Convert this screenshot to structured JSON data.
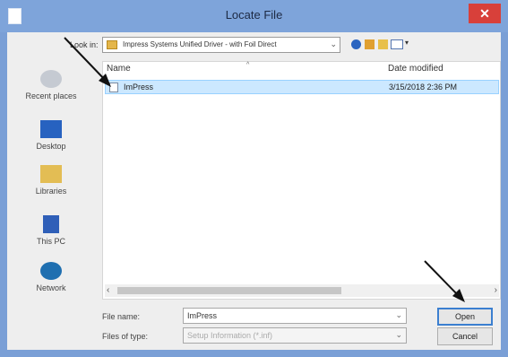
{
  "window": {
    "title": "Locate File",
    "close_glyph": "✕"
  },
  "toolbar": {
    "look_in_label": "Look in:",
    "look_in_value": "Impress Systems Unified Driver - with Foil Direct",
    "look_in_icon": "folder-icon",
    "icons": [
      "back-icon",
      "up-folder-icon",
      "new-folder-icon",
      "views-menu-icon"
    ]
  },
  "places": [
    {
      "label": "Recent places",
      "icon": "recent-places-icon"
    },
    {
      "label": "Desktop",
      "icon": "desktop-icon"
    },
    {
      "label": "Libraries",
      "icon": "libraries-icon"
    },
    {
      "label": "This PC",
      "icon": "this-pc-icon"
    },
    {
      "label": "Network",
      "icon": "network-icon"
    }
  ],
  "filelist": {
    "columns": {
      "name": "Name",
      "date": "Date modified"
    },
    "rows": [
      {
        "name": "ImPress",
        "date": "3/15/2018 2:36 PM",
        "selected": true
      }
    ]
  },
  "form": {
    "file_name_label": "File name:",
    "file_name_value": "ImPress",
    "files_of_type_label": "Files of type:",
    "files_of_type_value": "Setup Information (*.inf)"
  },
  "buttons": {
    "open": "Open",
    "cancel": "Cancel"
  },
  "colors": {
    "titlebar": "#7ea4da",
    "close": "#d8403a",
    "selection": "#cce8ff",
    "focus_border": "#3b7fd0"
  }
}
